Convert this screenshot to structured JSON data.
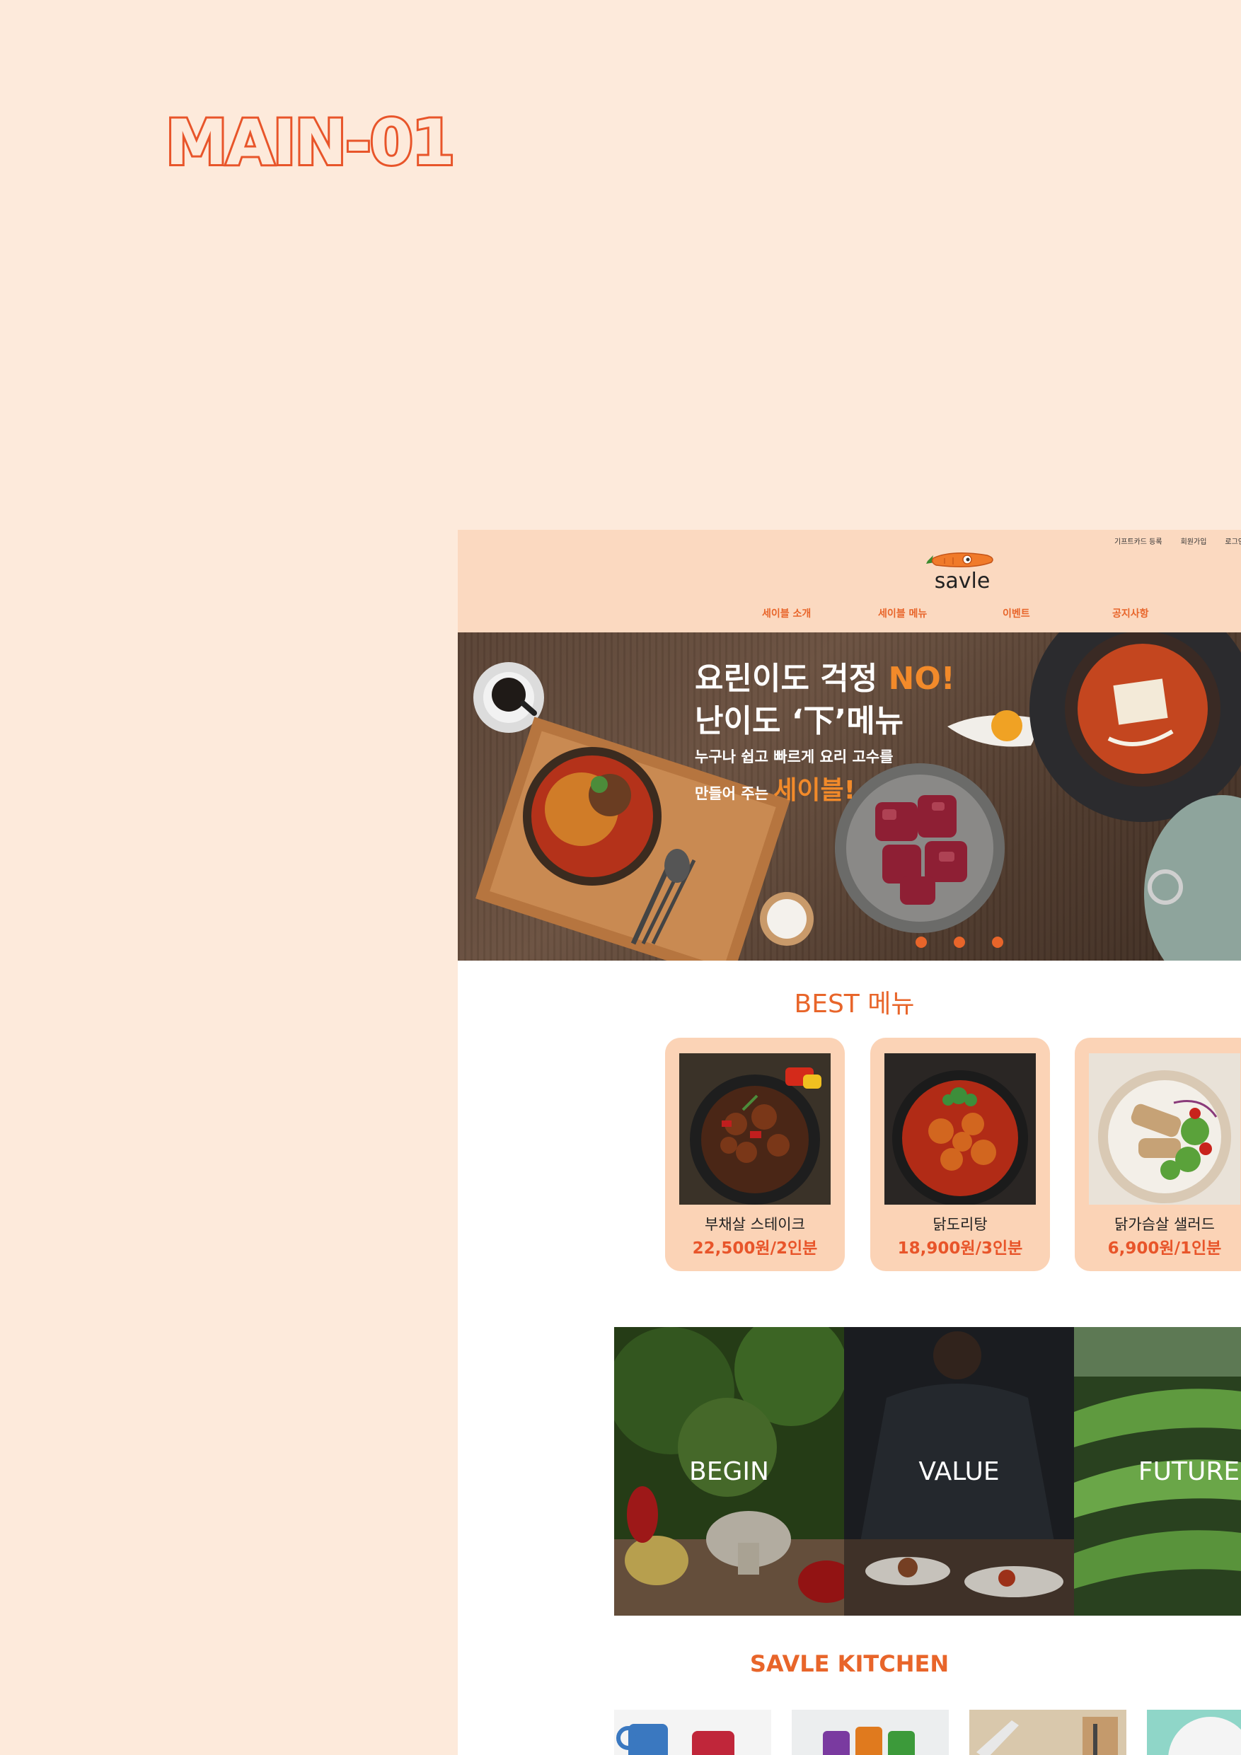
{
  "page_label": "MAIN-01",
  "header": {
    "util_links": [
      "기프트카드 등록",
      "회원가입",
      "로그인"
    ],
    "logo_text": "savle",
    "nav": [
      "세이블 소개",
      "세이블 메뉴",
      "이벤트",
      "공지사항"
    ]
  },
  "hero": {
    "line1_a": "요린이도 걱정 ",
    "line1_b": "NO!",
    "line2": "난이도 ‘下’메뉴",
    "line3": "누구나 쉽고 빠르게 요리 고수를",
    "line4_a": "만들어 주는 ",
    "line4_b": "세이블!",
    "slides": 3,
    "active_slide": 1
  },
  "best": {
    "title": "BEST 메뉴",
    "items": [
      {
        "name": "부채살 스테이크",
        "price": "22,500원/2인분"
      },
      {
        "name": "닭도리탕",
        "price": "18,900원/3인분"
      },
      {
        "name": "닭가슴살 샐러드",
        "price": "6,900원/1인분"
      }
    ]
  },
  "panels": [
    "BEGIN",
    "VALUE",
    "FUTURE"
  ],
  "kitchen": {
    "title": "SAVLE KITCHEN"
  },
  "colors": {
    "bg": "#fdeadb",
    "accent": "#e8652a",
    "header": "#fbd9c0",
    "card": "#fbd3b6"
  }
}
